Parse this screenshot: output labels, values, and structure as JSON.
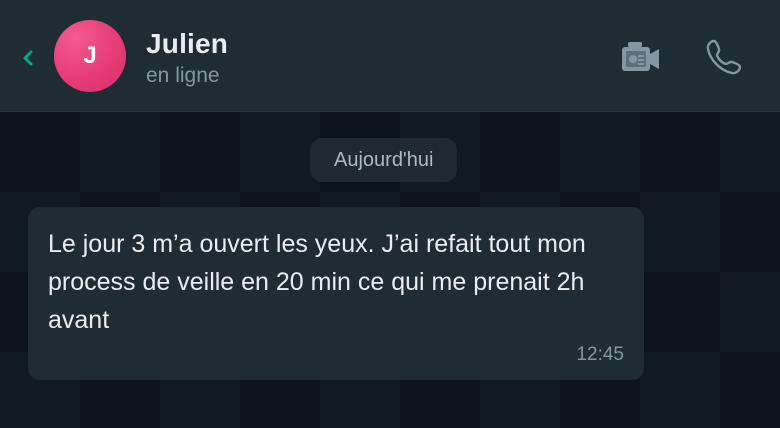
{
  "header": {
    "back_icon": "chevron-left-icon",
    "avatar_initial": "J",
    "contact_name": "Julien",
    "status": "en ligne",
    "video_call_icon": "video-camera-icon",
    "voice_call_icon": "phone-icon"
  },
  "chat": {
    "date_separator": "Aujourd'hui",
    "messages": [
      {
        "direction": "incoming",
        "text": "Le jour 3 m’a ouvert les yeux. J’ai refait tout mon process de veille en 20 min ce qui me prenait 2h avant",
        "time": "12:45"
      }
    ]
  },
  "colors": {
    "header_bg": "#1f2c34",
    "chat_bg": "#0b141a",
    "bubble_bg": "#202c33",
    "accent_green": "#00a884",
    "avatar_pink": "#e63c78",
    "primary_text": "#e9edef",
    "secondary_text": "#8696a0"
  }
}
